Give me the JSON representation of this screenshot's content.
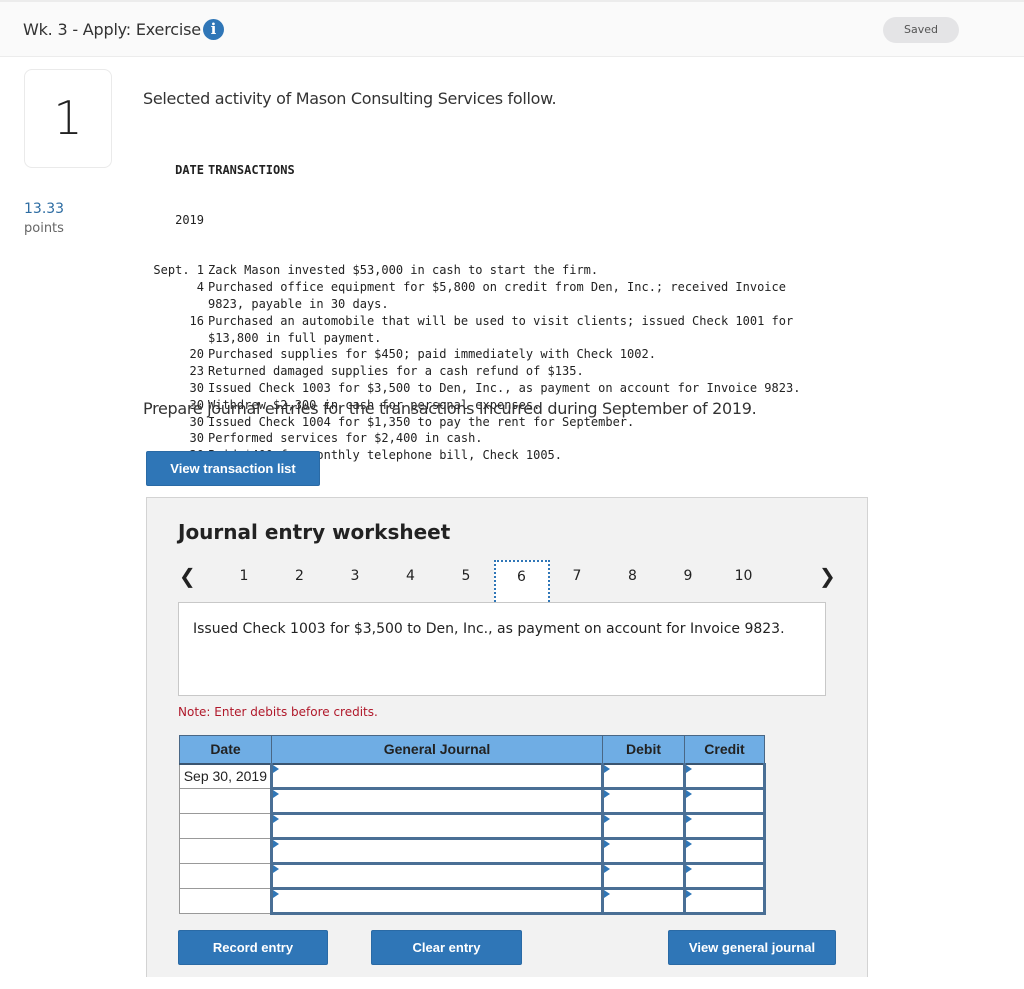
{
  "header": {
    "title": "Wk. 3 - Apply: Exercise",
    "info_icon": "i",
    "saved_label": "Saved"
  },
  "question": {
    "number": "1",
    "points_value": "13.33",
    "points_label": "points",
    "intro": "Selected activity of Mason Consulting Services follow.",
    "table_headers": {
      "date": "DATE",
      "transactions": "TRANSACTIONS"
    },
    "year": "2019",
    "transactions": [
      {
        "date": "Sept. 1",
        "text": "Zack Mason invested $53,000 in cash to start the firm."
      },
      {
        "date": "4",
        "text": "Purchased office equipment for $5,800 on credit from Den, Inc.; received Invoice 9823, payable in 30 days."
      },
      {
        "date": "16",
        "text": "Purchased an automobile that will be used to visit clients; issued Check 1001 for $13,800 in full payment."
      },
      {
        "date": "20",
        "text": "Purchased supplies for $450; paid immediately with Check 1002."
      },
      {
        "date": "23",
        "text": "Returned damaged supplies for a cash refund of $135."
      },
      {
        "date": "30",
        "text": "Issued Check 1003 for $3,500 to Den, Inc., as payment on account for Invoice 9823."
      },
      {
        "date": "30",
        "text": "Withdrew $2,300 in cash for personal expenses."
      },
      {
        "date": "30",
        "text": "Issued Check 1004 for $1,350 to pay the rent for September."
      },
      {
        "date": "30",
        "text": "Performed services for $2,400 in cash."
      },
      {
        "date": "30",
        "text": "Paid $400 for monthly telephone bill, Check 1005."
      }
    ],
    "prompt": "Prepare journal entries for the transactions incurred during September of 2019.",
    "view_transaction_list_label": "View transaction list"
  },
  "worksheet": {
    "title": "Journal entry worksheet",
    "pages": [
      "1",
      "2",
      "3",
      "4",
      "5",
      "6",
      "7",
      "8",
      "9",
      "10"
    ],
    "active_page": "6",
    "prev_icon": "❮",
    "next_icon": "❯",
    "description": "Issued Check 1003 for $3,500 to Den, Inc., as payment on account for Invoice 9823.",
    "note": "Note: Enter debits before credits.",
    "columns": {
      "date": "Date",
      "general_journal": "General Journal",
      "debit": "Debit",
      "credit": "Credit"
    },
    "rows": [
      {
        "date": "Sep 30, 2019",
        "account": "",
        "debit": "",
        "credit": ""
      },
      {
        "date": "",
        "account": "",
        "debit": "",
        "credit": ""
      },
      {
        "date": "",
        "account": "",
        "debit": "",
        "credit": ""
      },
      {
        "date": "",
        "account": "",
        "debit": "",
        "credit": ""
      },
      {
        "date": "",
        "account": "",
        "debit": "",
        "credit": ""
      },
      {
        "date": "",
        "account": "",
        "debit": "",
        "credit": ""
      }
    ],
    "record_entry_label": "Record entry",
    "clear_entry_label": "Clear entry",
    "view_general_journal_label": "View general journal"
  },
  "colors": {
    "accent": "#2f76b7",
    "table_header": "#6fade4",
    "note_red": "#b0182a",
    "points_blue": "#2d6ca2"
  }
}
